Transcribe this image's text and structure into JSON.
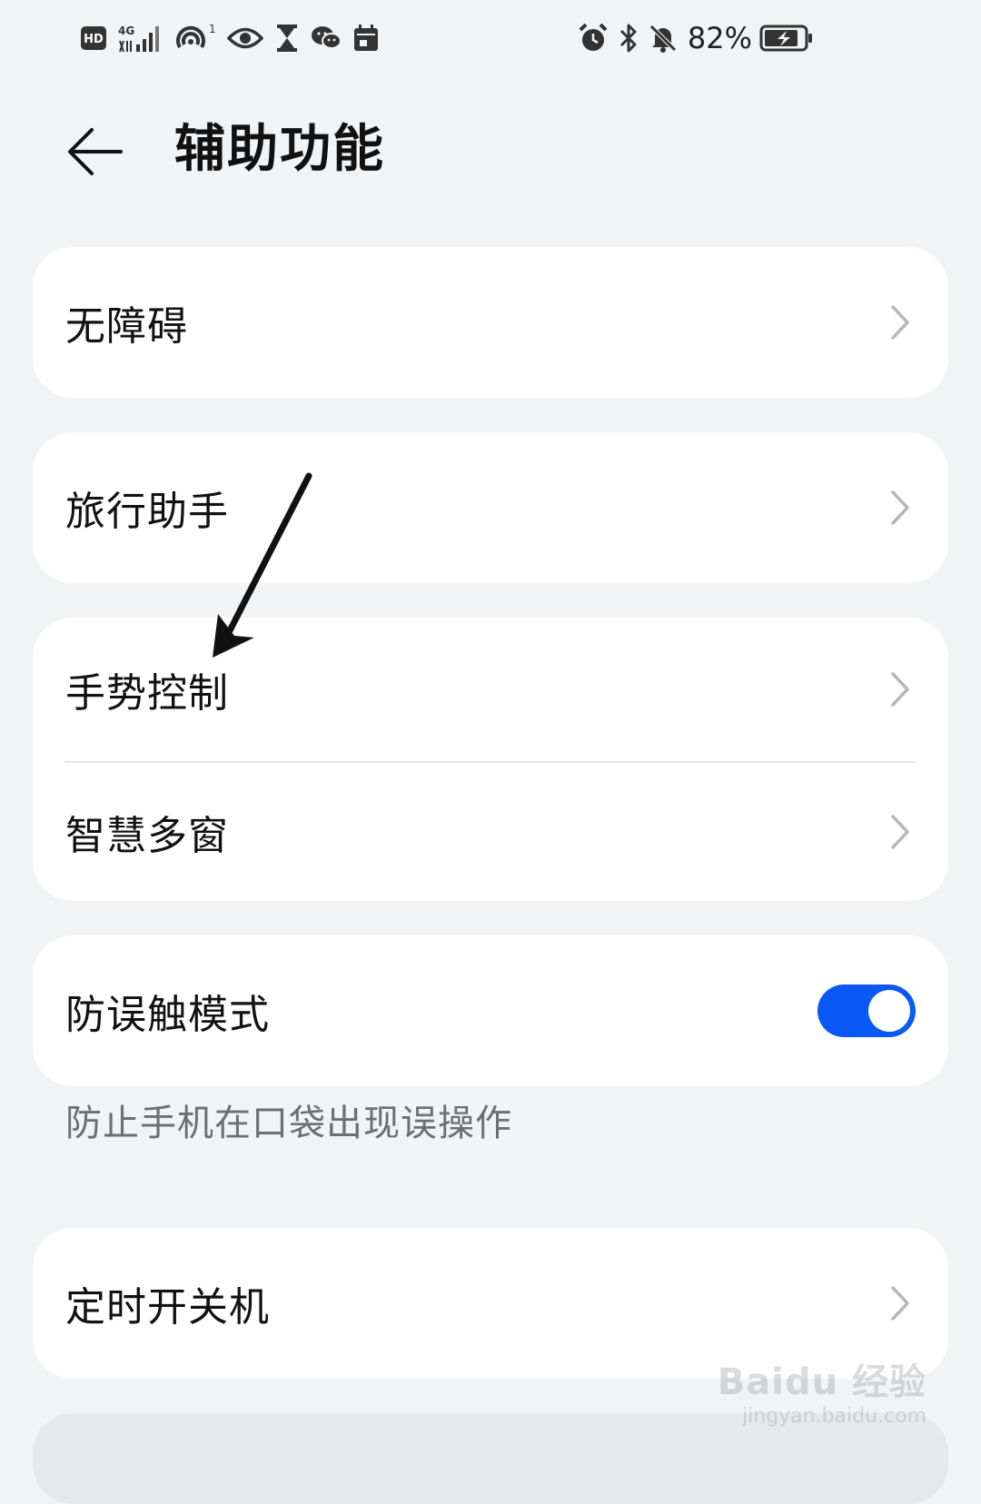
{
  "status_bar": {
    "battery_percent": "82%",
    "signal_label": "4G",
    "hd_label": "HD",
    "hotspot_count": "1",
    "left_icons": [
      "hd-icon",
      "signal-4g-icon",
      "hotspot-icon",
      "eye-icon",
      "hourglass-icon",
      "wechat-icon",
      "calendar-icon"
    ],
    "right_icons": [
      "alarm-icon",
      "bluetooth-icon",
      "mute-icon",
      "battery-icon"
    ]
  },
  "header": {
    "title": "辅助功能",
    "back_icon": "arrow-left-icon"
  },
  "settings": {
    "accessibility": "无障碍",
    "travel_assistant": "旅行助手",
    "gesture_control": "手势控制",
    "smart_multiwindow": "智慧多窗",
    "anti_mistouch": "防误触模式",
    "anti_mistouch_enabled": true,
    "anti_mistouch_caption": "防止手机在口袋出现误操作",
    "scheduled_power": "定时开关机"
  },
  "watermark": {
    "logo": "Baidu 经验",
    "url": "jingyan.baidu.com"
  },
  "colors": {
    "background": "#f1f3f5",
    "card": "#ffffff",
    "accent": "#0a59f7",
    "text_primary": "#111111",
    "text_secondary": "#6c6f73"
  }
}
